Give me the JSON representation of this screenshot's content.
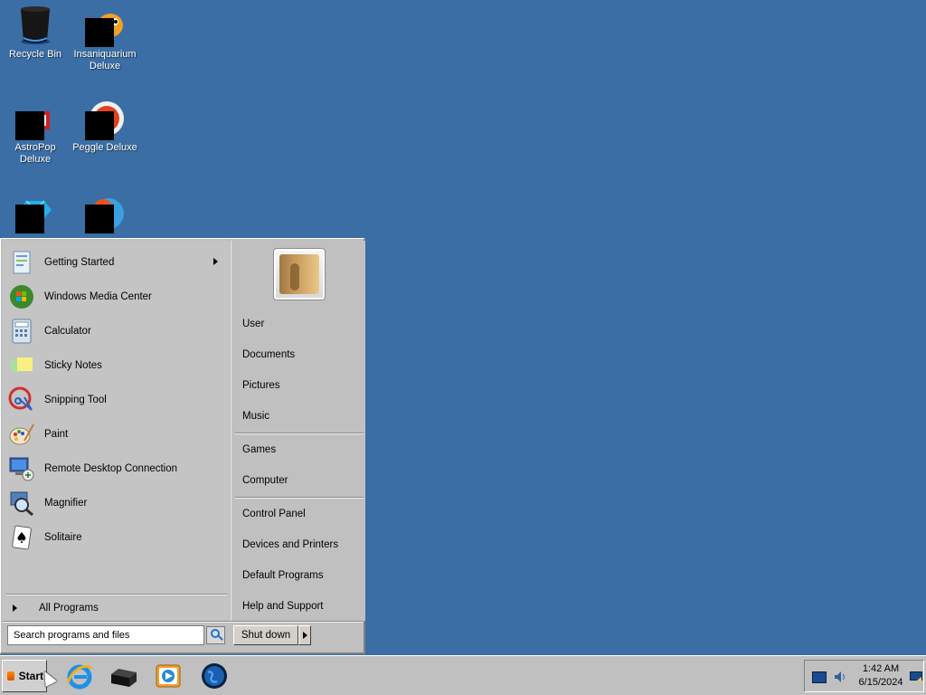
{
  "desktop": {
    "icons": [
      {
        "label": "Recycle Bin"
      },
      {
        "label": "Insaniquarium Deluxe"
      },
      {
        "label": "AstroPop Deluxe"
      },
      {
        "label": "Peggle Deluxe"
      },
      {
        "label": ""
      },
      {
        "label": ""
      }
    ]
  },
  "start_menu": {
    "programs": [
      {
        "label": "Getting Started",
        "has_submenu": true,
        "icon": "getting-started-icon"
      },
      {
        "label": "Windows Media Center",
        "icon": "windows-media-center-icon"
      },
      {
        "label": "Calculator",
        "icon": "calculator-icon"
      },
      {
        "label": "Sticky Notes",
        "icon": "sticky-notes-icon"
      },
      {
        "label": "Snipping Tool",
        "icon": "snipping-tool-icon"
      },
      {
        "label": "Paint",
        "icon": "paint-icon"
      },
      {
        "label": "Remote Desktop Connection",
        "icon": "remote-desktop-icon"
      },
      {
        "label": "Magnifier",
        "icon": "magnifier-icon"
      },
      {
        "label": "Solitaire",
        "icon": "solitaire-icon"
      }
    ],
    "all_programs": "All Programs",
    "right_links": {
      "group1": [
        "User",
        "Documents",
        "Pictures",
        "Music"
      ],
      "group2": [
        "Games",
        "Computer"
      ],
      "group3": [
        "Control Panel",
        "Devices and Printers",
        "Default Programs",
        "Help and Support"
      ]
    },
    "search_placeholder": "Search programs and files",
    "shutdown_label": "Shut down"
  },
  "taskbar": {
    "start_label": "Start",
    "pinned": [
      "internet-explorer-icon",
      "game-box-icon",
      "media-player-icon",
      "globe-icon"
    ],
    "clock": {
      "time": "1:42 AM",
      "date": "6/15/2024"
    }
  },
  "colors": {
    "desktop": "#3a6ea5",
    "menu": "#c0c0c0"
  }
}
